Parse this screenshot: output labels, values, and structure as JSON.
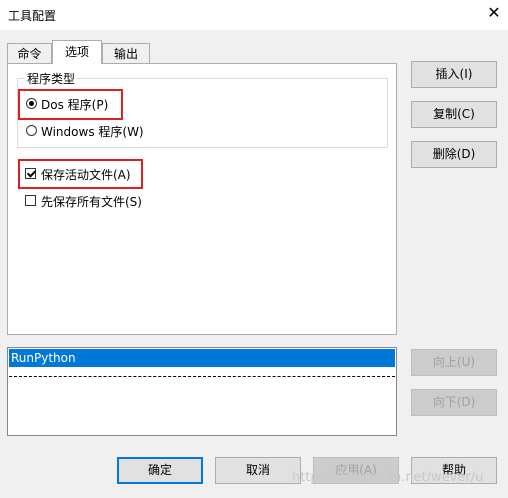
{
  "window": {
    "title": "工具配置",
    "close_icon": "close-icon"
  },
  "tabs": [
    {
      "label": "命令",
      "active": false
    },
    {
      "label": "选项",
      "active": true
    },
    {
      "label": "输出",
      "active": false
    }
  ],
  "program_type": {
    "group_label": "程序类型",
    "dos_label": "Dos 程序(P)",
    "windows_label": "Windows 程序(W)",
    "selected": "dos"
  },
  "options": {
    "save_active_label": "保存活动文件(A)",
    "save_active_checked": true,
    "save_all_label": "先保存所有文件(S)",
    "save_all_checked": false
  },
  "side_buttons": {
    "insert": "插入(I)",
    "copy": "复制(C)",
    "delete": "删除(D)",
    "up": "向上(U)",
    "down": "向下(D)"
  },
  "tool_list": {
    "items": [
      "RunPython"
    ],
    "selected": "RunPython"
  },
  "footer_buttons": {
    "ok": "确定",
    "cancel": "取消",
    "apply": "应用(A)",
    "help": "帮助"
  },
  "watermark": "https://blog.csdn.net/wever/u",
  "colors": {
    "highlight": "#e02020",
    "selection": "#0078d7"
  }
}
